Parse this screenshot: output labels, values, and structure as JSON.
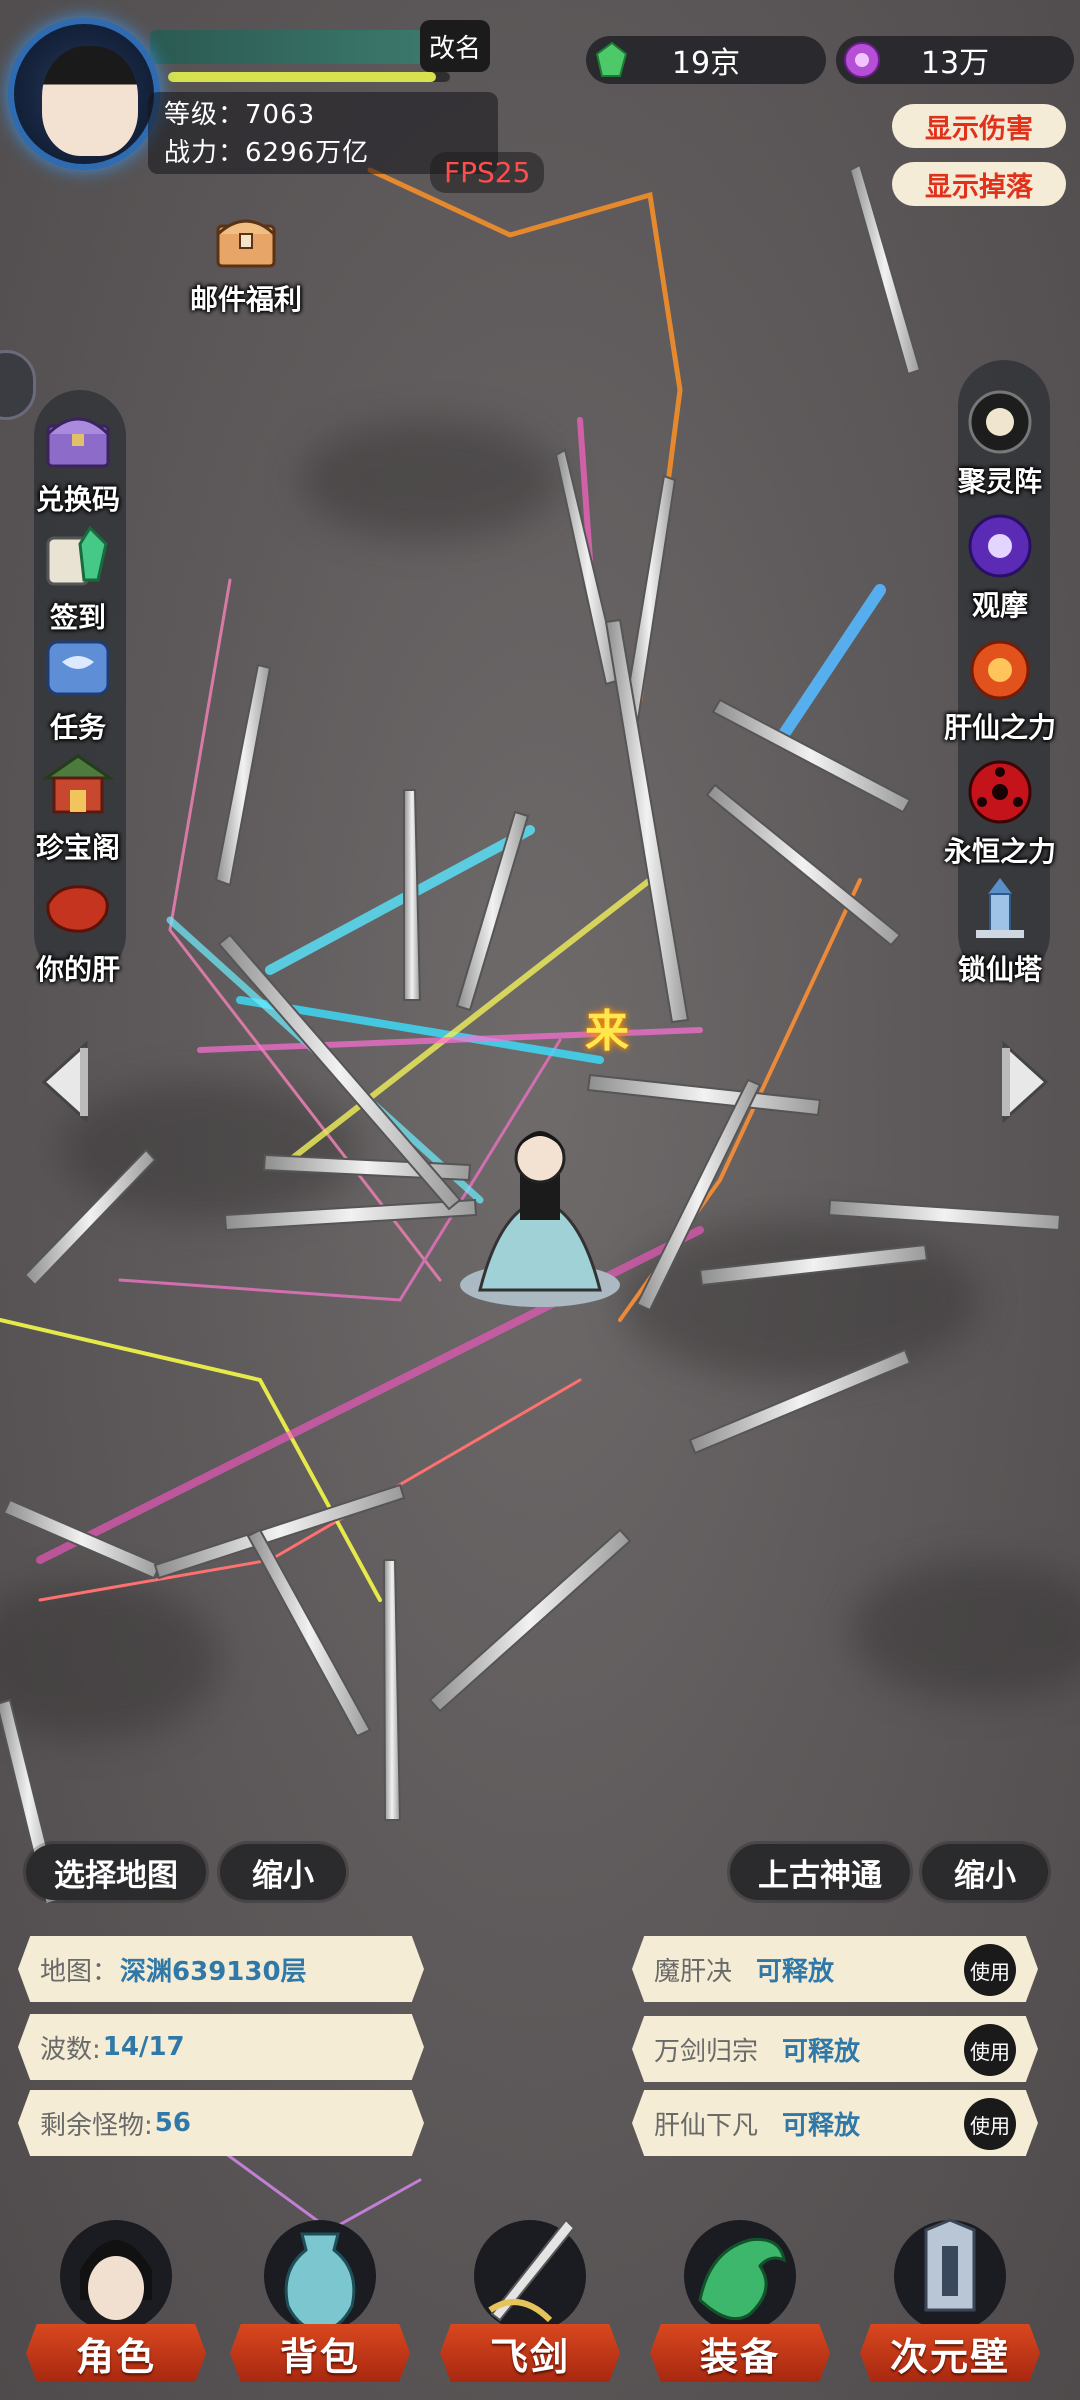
{
  "player": {
    "rename_label": "改名",
    "level_text": "等级：7063",
    "power_text": "战力：6296万亿",
    "xp_fraction": 0.95
  },
  "fps_label": "FPS25",
  "currency": {
    "jade": "19京",
    "orb": "13万"
  },
  "toggles": {
    "show_damage": "显示伤害",
    "show_drops": "显示掉落"
  },
  "mail_label": "邮件福利",
  "left_menu": [
    {
      "label": "兑换码",
      "icon": "treasure-chest-icon"
    },
    {
      "label": "签到",
      "icon": "scroll-crystal-icon"
    },
    {
      "label": "任务",
      "icon": "task-scroll-icon"
    },
    {
      "label": "珍宝阁",
      "icon": "pavilion-icon"
    },
    {
      "label": "你的肝",
      "icon": "liver-icon"
    }
  ],
  "right_menu": [
    {
      "label": "聚灵阵",
      "icon": "spirit-array-icon"
    },
    {
      "label": "观摩",
      "icon": "purple-orb-icon"
    },
    {
      "label": "肝仙之力",
      "icon": "fire-orb-icon"
    },
    {
      "label": "永恒之力",
      "icon": "red-eye-icon"
    },
    {
      "label": "锁仙塔",
      "icon": "tower-icon"
    }
  ],
  "battle_text": "来",
  "map_controls": {
    "select_map": "选择地图",
    "shrink_left": "缩小",
    "ancient_power": "上古神通",
    "shrink_right": "缩小"
  },
  "info_panel": {
    "map_label": "地图：",
    "map_value": "深渊639130层",
    "wave_label": "波数:",
    "wave_value": "14/17",
    "monsters_label": "剩余怪物:",
    "monsters_value": "56"
  },
  "skills": [
    {
      "name": "魔肝决",
      "state": "可释放",
      "use": "使用"
    },
    {
      "name": "万剑归宗",
      "state": "可释放",
      "use": "使用"
    },
    {
      "name": "肝仙下凡",
      "state": "可释放",
      "use": "使用"
    }
  ],
  "bottom_nav": [
    {
      "label": "角色",
      "icon": "character-icon"
    },
    {
      "label": "背包",
      "icon": "vase-bag-icon"
    },
    {
      "label": "飞剑",
      "icon": "flying-sword-icon"
    },
    {
      "label": "装备",
      "icon": "dragon-equipment-icon"
    },
    {
      "label": "次元壁",
      "icon": "dimension-wall-icon"
    }
  ],
  "colors": {
    "toggle_text": "#e0311b",
    "value_blue": "#2f78a8",
    "nav_red": "#c0391a",
    "fps_red": "#ff4d4d"
  }
}
